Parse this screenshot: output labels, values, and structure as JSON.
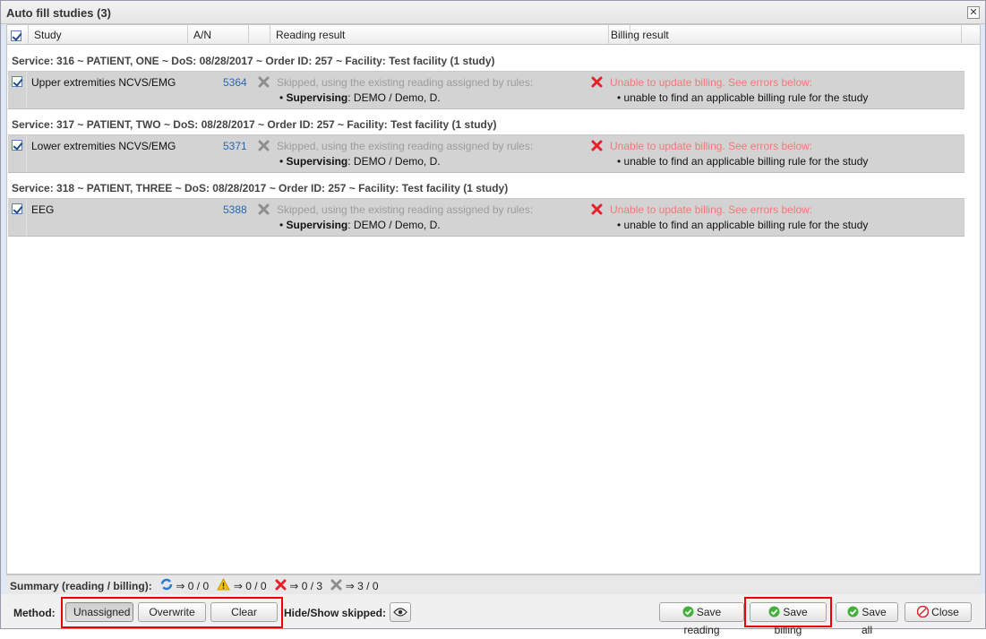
{
  "window": {
    "title": "Auto fill studies (3)",
    "close_glyph": "✕"
  },
  "columns": {
    "study": "Study",
    "an": "A/N",
    "reading": "Reading result",
    "billing": "Billing result"
  },
  "groups": [
    {
      "title": "Service: 316 ~ PATIENT, ONE ~ DoS: 08/28/2017 ~ Order ID: 257 ~ Facility: Test facility (1 study)",
      "study": "Upper extremities NCVS/EMG",
      "an": "5364",
      "reading_skip": "Skipped, using the existing reading assigned by rules:",
      "sup_label": "Supervising",
      "sup_value": ": DEMO / Demo, D.",
      "billing_error": "Unable to update billing. See errors below:",
      "billing_detail": "• unable to find an applicable billing rule for the study"
    },
    {
      "title": "Service: 317 ~ PATIENT, TWO ~ DoS: 08/28/2017 ~ Order ID: 257 ~ Facility: Test facility (1 study)",
      "study": "Lower extremities NCVS/EMG",
      "an": "5371",
      "reading_skip": "Skipped, using the existing reading assigned by rules:",
      "sup_label": "Supervising",
      "sup_value": ": DEMO / Demo, D.",
      "billing_error": "Unable to update billing. See errors below:",
      "billing_detail": "• unable to find an applicable billing rule for the study"
    },
    {
      "title": "Service: 318 ~ PATIENT, THREE ~ DoS: 08/28/2017 ~ Order ID: 257 ~ Facility: Test facility (1 study)",
      "study": "EEG",
      "an": "5388",
      "reading_skip": "Skipped, using the existing reading assigned by rules:",
      "sup_label": "Supervising",
      "sup_value": ": DEMO / Demo, D.",
      "billing_error": "Unable to update billing. See errors below:",
      "billing_detail": "• unable to find an applicable billing rule for the study"
    }
  ],
  "summary": {
    "label": "Summary (reading / billing):",
    "arrow": "⇒",
    "refresh": "0 / 0",
    "warning": "0 / 0",
    "error": "0 / 3",
    "skipped": "3 / 0"
  },
  "footer": {
    "method_label": "Method:",
    "method_options": [
      "Unassigned",
      "Overwrite",
      "Clear"
    ],
    "selected_method": "Unassigned",
    "hide_show_label": "Hide/Show skipped:",
    "save_reading": "Save reading",
    "save_billing": "Save billing",
    "save_all": "Save all",
    "close": "Close"
  },
  "colors": {
    "error_text": "#f07a7a",
    "link": "#2a67b1",
    "highlight": "#e00000",
    "row_bg": "#d3d3d3"
  }
}
